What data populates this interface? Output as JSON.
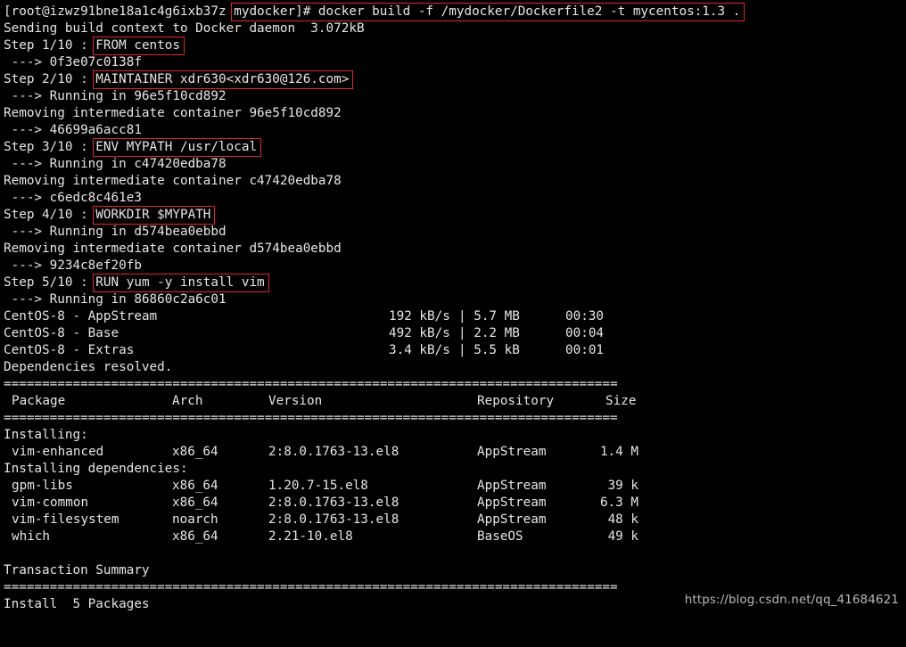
{
  "prompt": {
    "user_host": "[root@izwz91bne18a1c4g6ixb37z",
    "cwd_and_command": "mydocker]# docker build -f /mydocker/Dockerfile2 -t mycentos:1.3 ."
  },
  "build": {
    "sending": "Sending build context to Docker daemon  3.072kB",
    "steps": [
      {
        "label": "Step 1/10 : ",
        "instruction": "FROM centos"
      },
      {
        "label": "Step 2/10 : ",
        "instruction": "MAINTAINER xdr630<xdr630@126.com>"
      },
      {
        "label": "Step 3/10 : ",
        "instruction": "ENV MYPATH /usr/local"
      },
      {
        "label": "Step 4/10 : ",
        "instruction": "WORKDIR $MYPATH"
      },
      {
        "label": "Step 5/10 : ",
        "instruction": "RUN yum -y install vim"
      }
    ],
    "lines": {
      "arrow_1": " ---> 0f3e07c0138f",
      "running_2": " ---> Running in 96e5f10cd892",
      "removing_2": "Removing intermediate container 96e5f10cd892",
      "arrow_2": " ---> 46699a6acc81",
      "running_3": " ---> Running in c47420edba78",
      "removing_3": "Removing intermediate container c47420edba78",
      "arrow_3": " ---> c6edc8c461e3",
      "running_4": " ---> Running in d574bea0ebbd",
      "removing_4": "Removing intermediate container d574bea0ebbd",
      "arrow_4": " ---> 9234c8ef20fb",
      "running_5": " ---> Running in 86860c2a6c01"
    }
  },
  "repos": [
    {
      "name": "CentOS-8 - AppStream",
      "speed": "192 kB/s",
      "size": "| 5.7 MB",
      "time": "00:30"
    },
    {
      "name": "CentOS-8 - Base",
      "speed": "492 kB/s",
      "size": "| 2.2 MB",
      "time": "00:04"
    },
    {
      "name": "CentOS-8 - Extras",
      "speed": "3.4 kB/s",
      "size": "| 5.5 kB",
      "time": "00:01"
    }
  ],
  "dependencies_resolved": "Dependencies resolved.",
  "separator": "================================================================================",
  "table": {
    "headers": {
      "package": "Package",
      "arch": "Arch",
      "version": "Version",
      "repository": "Repository",
      "size": "Size"
    },
    "installing_label": "Installing:",
    "installing": [
      {
        "package": "vim-enhanced",
        "arch": "x86_64",
        "version": "2:8.0.1763-13.el8",
        "repository": "AppStream",
        "size": "1.4 M"
      }
    ],
    "dependencies_label": "Installing dependencies:",
    "dependencies": [
      {
        "package": "gpm-libs",
        "arch": "x86_64",
        "version": "1.20.7-15.el8",
        "repository": "AppStream",
        "size": "39 k"
      },
      {
        "package": "vim-common",
        "arch": "x86_64",
        "version": "2:8.0.1763-13.el8",
        "repository": "AppStream",
        "size": "6.3 M"
      },
      {
        "package": "vim-filesystem",
        "arch": "noarch",
        "version": "2:8.0.1763-13.el8",
        "repository": "AppStream",
        "size": "48 k"
      },
      {
        "package": "which",
        "arch": "x86_64",
        "version": "2.21-10.el8",
        "repository": "BaseOS",
        "size": "49 k"
      }
    ]
  },
  "transaction_summary": "Transaction Summary",
  "install_line": "Install  5 Packages",
  "watermark": "https://blog.csdn.net/qq_41684621",
  "colors": {
    "background": "#000000",
    "text": "#e6e6e6",
    "highlight_box": "#e2262a"
  }
}
